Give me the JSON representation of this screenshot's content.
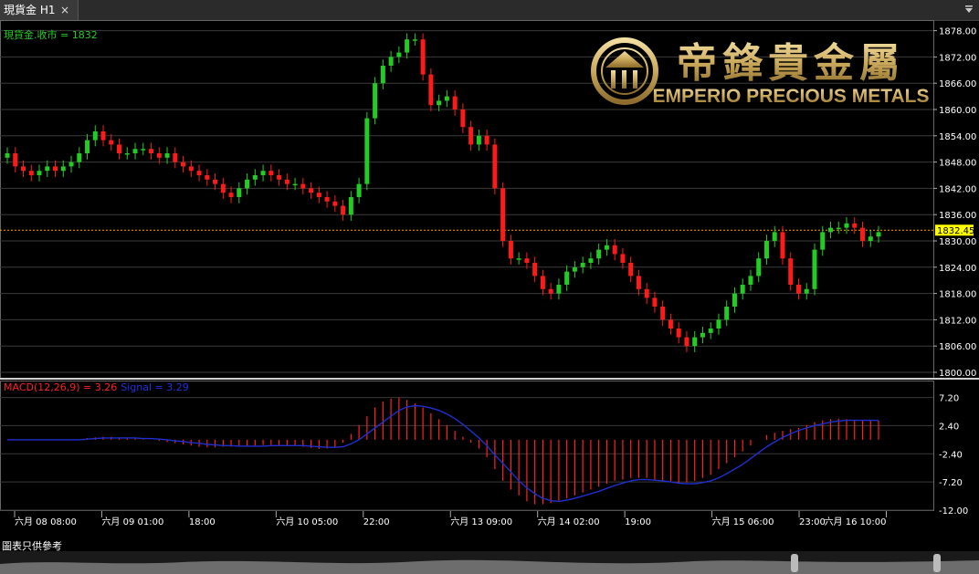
{
  "window": {
    "tab_label": "現貨金 H1",
    "close_glyph": "×"
  },
  "legend": {
    "main": "現貨金.收市 = 1832",
    "macd": "MACD(12,26,9) = 3.26",
    "signal": "Signal = 3.29"
  },
  "logo": {
    "cn": "帝鋒貴金屬",
    "en": "EMPERIO PRECIOUS METALS"
  },
  "price_axis": {
    "min": 1800,
    "max": 1880,
    "ticks": [
      "1878.00",
      "1872.00",
      "1866.00",
      "1860.00",
      "1854.00",
      "1848.00",
      "1842.00",
      "1836.00",
      "1830.00",
      "1824.00",
      "1818.00",
      "1812.00",
      "1806.00",
      "1800.00"
    ],
    "current": "1832.45"
  },
  "macd_axis": {
    "ticks": [
      "7.20",
      "2.40",
      "-2.40",
      "-7.20",
      "-12.00"
    ]
  },
  "time_axis": {
    "labels": [
      "六月 08 08:00",
      "六月 09 01:00",
      "18:00",
      "六月 10 05:00",
      "22:00",
      "六月 13 09:00",
      "六月 14 02:00",
      "19:00",
      "六月 15 06:00",
      "23:00",
      "六月 16 10:00"
    ]
  },
  "footer": {
    "note": "圖表只供參考"
  },
  "colors": {
    "up": "#22cc22",
    "down": "#ff1a1a",
    "macd_hist": "#ff2020",
    "signal": "#1f2fd0",
    "current_line": "#ff9900",
    "current_tag": "#ffff00"
  },
  "chart_data": [
    {
      "type": "candlestick",
      "title": "現貨金 H1",
      "current_price": 1832.45,
      "close_approx": [
        1850,
        1847,
        1846,
        1845,
        1846,
        1847,
        1846,
        1847,
        1848,
        1850,
        1853,
        1855,
        1853,
        1852,
        1850,
        1850,
        1851,
        1851,
        1850,
        1849,
        1850,
        1848,
        1847,
        1846,
        1845,
        1844,
        1843,
        1841,
        1840,
        1842,
        1844,
        1845,
        1846,
        1845,
        1844,
        1843,
        1843,
        1842,
        1841,
        1840,
        1839,
        1838,
        1836,
        1840,
        1843,
        1858,
        1866,
        1870,
        1872,
        1873,
        1876,
        1876,
        1868,
        1861,
        1862,
        1863,
        1860,
        1856,
        1852,
        1854,
        1852,
        1842,
        1830,
        1826,
        1826,
        1825,
        1822,
        1819,
        1818,
        1820,
        1823,
        1824,
        1825,
        1826,
        1828,
        1829,
        1827,
        1825,
        1822,
        1819,
        1817,
        1815,
        1812,
        1810,
        1808,
        1806,
        1808,
        1809,
        1810,
        1812,
        1815,
        1818,
        1820,
        1822,
        1826,
        1830,
        1832,
        1826,
        1820,
        1818,
        1819,
        1828,
        1832,
        1833,
        1833,
        1834,
        1833,
        1830,
        1831,
        1832
      ]
    },
    {
      "type": "bar",
      "title": "MACD(12,26,9)",
      "macd_last": 3.26,
      "signal_last": 3.29,
      "ylim": [
        -12,
        9
      ],
      "macd_approx": [
        0,
        0,
        0,
        0,
        0,
        0,
        0,
        0,
        0,
        0,
        0.3,
        0.4,
        0.5,
        0.5,
        0.4,
        0.3,
        0.2,
        0.1,
        0,
        -0.2,
        -0.4,
        -0.6,
        -0.8,
        -1,
        -1.2,
        -1.3,
        -1.3,
        -1.2,
        -1.2,
        -1.1,
        -1,
        -1,
        -0.9,
        -0.9,
        -1,
        -1,
        -1.1,
        -1.2,
        -1.4,
        -1.6,
        -1.5,
        -1.2,
        -0.5,
        1,
        2.5,
        4,
        5.5,
        6.5,
        7,
        7.2,
        6.8,
        6.2,
        5.5,
        4.5,
        3.5,
        2.5,
        1.5,
        0.5,
        -0.5,
        -1.5,
        -3,
        -5,
        -7,
        -8.5,
        -9.5,
        -10.5,
        -11,
        -11,
        -10.8,
        -10.4,
        -10,
        -9.5,
        -9,
        -8.5,
        -8,
        -7.5,
        -7,
        -6.8,
        -6.5,
        -6.5,
        -6.5,
        -6.8,
        -7,
        -7.2,
        -7.5,
        -7.3,
        -7,
        -6.5,
        -6,
        -5,
        -4,
        -3,
        -2,
        -1,
        0,
        0.8,
        1.2,
        1.5,
        1.8,
        2,
        2.5,
        3,
        3.3,
        3.5,
        3.6,
        3.5,
        3.4,
        3.3,
        3.3,
        3.26
      ],
      "signal_approx": [
        0,
        0,
        0,
        0,
        0,
        0,
        0,
        0,
        0,
        0,
        0.1,
        0.2,
        0.3,
        0.3,
        0.3,
        0.3,
        0.3,
        0.2,
        0.2,
        0.1,
        0,
        -0.2,
        -0.3,
        -0.5,
        -0.6,
        -0.8,
        -0.9,
        -1,
        -1,
        -1.1,
        -1.1,
        -1.1,
        -1.1,
        -1,
        -1,
        -1,
        -1,
        -1,
        -1.1,
        -1.2,
        -1.3,
        -1.3,
        -1.2,
        -0.7,
        0,
        1,
        2,
        3,
        4,
        5,
        5.6,
        5.8,
        5.7,
        5.4,
        5,
        4.4,
        3.6,
        2.6,
        1.5,
        0.3,
        -1,
        -2.6,
        -4,
        -5.5,
        -7,
        -8.2,
        -9.2,
        -10,
        -10.4,
        -10.5,
        -10.3,
        -10,
        -9.6,
        -9.2,
        -8.8,
        -8.3,
        -7.8,
        -7.4,
        -7,
        -6.8,
        -6.8,
        -6.9,
        -7,
        -7.2,
        -7.4,
        -7.5,
        -7.5,
        -7.3,
        -7,
        -6.5,
        -5.8,
        -5,
        -4.2,
        -3.2,
        -2.2,
        -1.2,
        -0.4,
        0.4,
        1,
        1.6,
        2,
        2.4,
        2.7,
        3,
        3.2,
        3.3,
        3.3,
        3.3,
        3.3,
        3.29
      ]
    }
  ]
}
